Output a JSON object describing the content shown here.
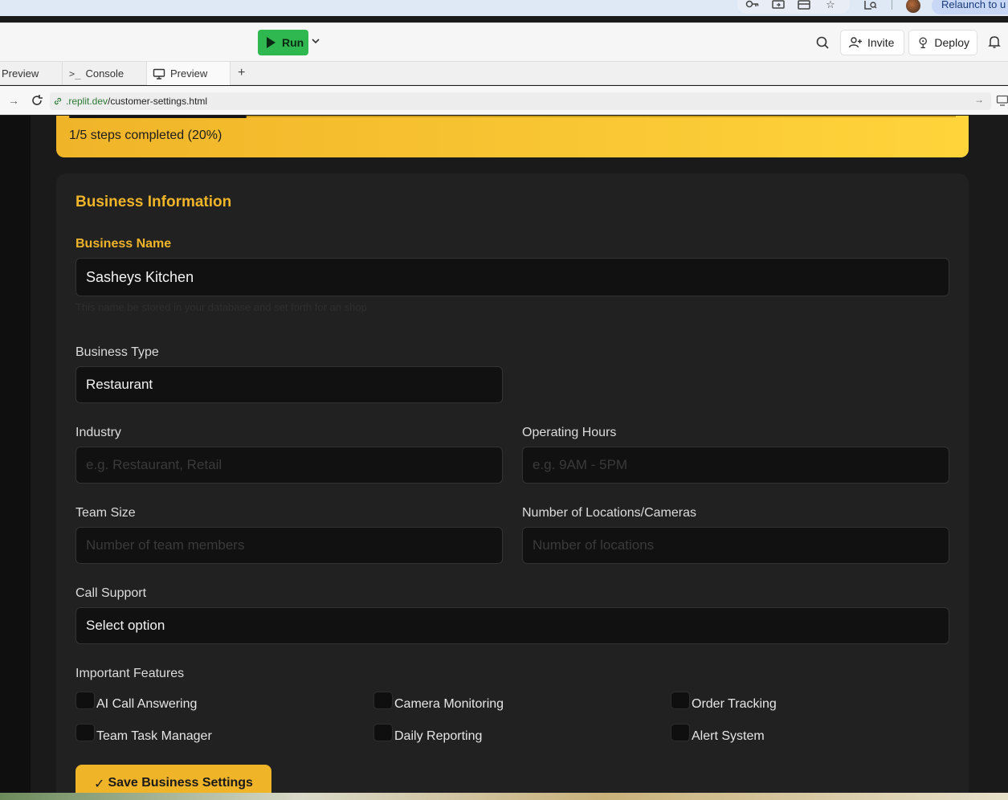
{
  "browser": {
    "relaunch_label": "Relaunch to u"
  },
  "header": {
    "run_label": "Run",
    "invite_label": "Invite",
    "deploy_label": "Deploy"
  },
  "tabs": [
    {
      "label": "Preview"
    },
    {
      "label": "Console"
    },
    {
      "label": "Preview"
    }
  ],
  "address": {
    "host": ".replit.dev",
    "path": "/customer-settings.html"
  },
  "progress": {
    "text": "1/5 steps completed (20%)",
    "fraction": 0.2
  },
  "form": {
    "section_title": "Business Information",
    "business_name_label": "Business Name",
    "business_name_value": "Sasheys Kitchen",
    "business_name_helper": "This name be stored in your database and set forth for an shop",
    "business_type_label": "Business Type",
    "business_type_value": "Restaurant",
    "industry_label": "Industry",
    "industry_placeholder": "e.g. Restaurant, Retail",
    "hours_label": "Operating Hours",
    "hours_placeholder": "e.g. 9AM - 5PM",
    "team_size_label": "Team Size",
    "team_size_placeholder": "Number of team members",
    "locations_label": "Number of Locations/Cameras",
    "locations_placeholder": "Number of locations",
    "call_support_label": "Call Support",
    "call_support_value": "Select option",
    "features_label": "Important Features",
    "features": [
      "AI Call Answering",
      "Camera Monitoring",
      "Order Tracking",
      "Team Task Manager",
      "Daily Reporting",
      "Alert System"
    ],
    "save_label": "Save Business Settings"
  },
  "colors": {
    "accent": "#f0b429",
    "run_green": "#2fb84f"
  }
}
